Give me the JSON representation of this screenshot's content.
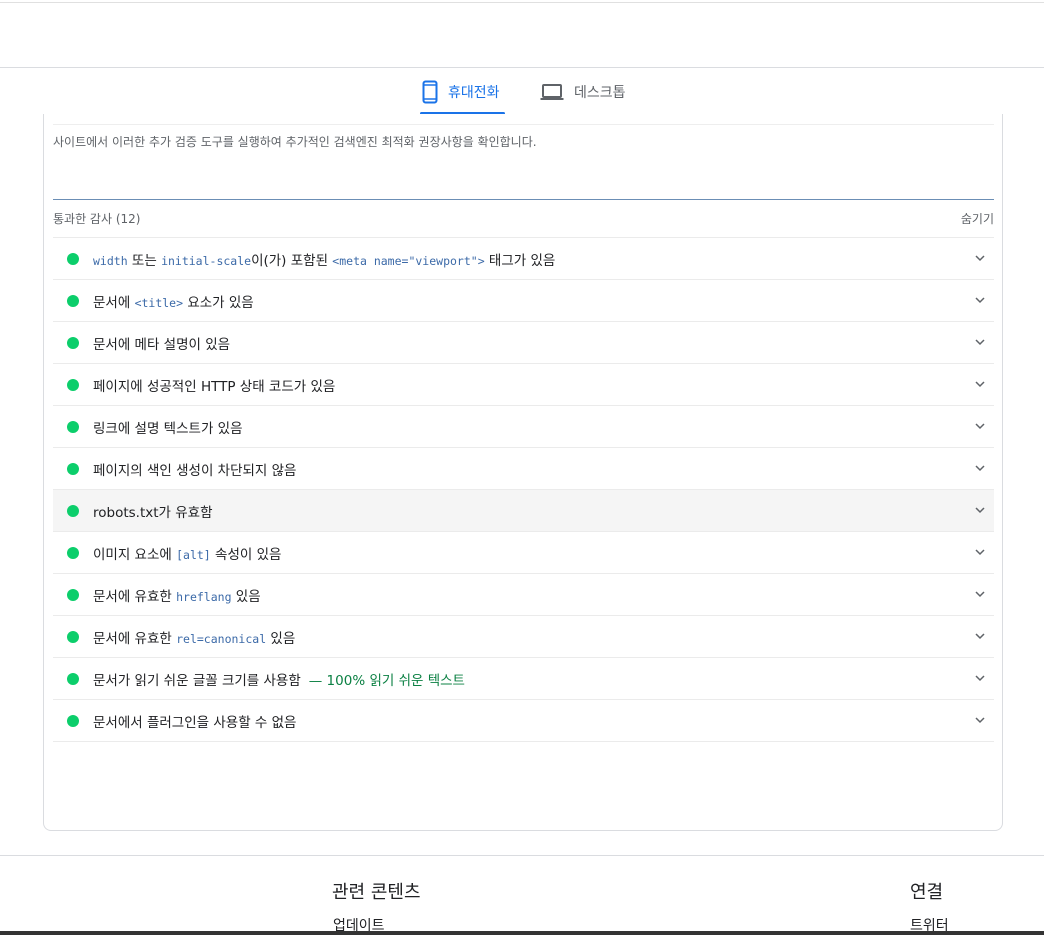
{
  "tabs": {
    "mobile_label": "휴대전화",
    "desktop_label": "데스크톱"
  },
  "description": "사이트에서 이러한 추가 검증 도구를 실행하여 추가적인 검색엔진 최적화 권장사항을 확인합니다.",
  "passed_section": {
    "title": "통과한 감사 (12)",
    "toggle_label": "숨기기"
  },
  "audits": [
    {
      "status": "pass",
      "parts": [
        {
          "t": "width",
          "code": true
        },
        {
          "t": " 또는 "
        },
        {
          "t": "initial-scale",
          "code": true
        },
        {
          "t": "이(가) 포함된 "
        },
        {
          "t": "<meta name=\"viewport\">",
          "code": true
        },
        {
          "t": " 태그가 있음"
        }
      ]
    },
    {
      "status": "pass",
      "parts": [
        {
          "t": "문서에 "
        },
        {
          "t": "<title>",
          "code": true
        },
        {
          "t": " 요소가 있음"
        }
      ]
    },
    {
      "status": "pass",
      "parts": [
        {
          "t": "문서에 메타 설명이 있음"
        }
      ]
    },
    {
      "status": "pass",
      "parts": [
        {
          "t": "페이지에 성공적인 HTTP 상태 코드가 있음"
        }
      ]
    },
    {
      "status": "pass",
      "parts": [
        {
          "t": "링크에 설명 텍스트가 있음"
        }
      ]
    },
    {
      "status": "pass",
      "parts": [
        {
          "t": "페이지의 색인 생성이 차단되지 않음"
        }
      ]
    },
    {
      "status": "pass",
      "parts": [
        {
          "t": "robots.txt가 유효함"
        }
      ],
      "highlight": true
    },
    {
      "status": "pass",
      "parts": [
        {
          "t": "이미지 요소에 "
        },
        {
          "t": "[alt]",
          "code": true
        },
        {
          "t": " 속성이 있음"
        }
      ]
    },
    {
      "status": "pass",
      "parts": [
        {
          "t": "문서에 유효한 "
        },
        {
          "t": "hreflang",
          "code": true
        },
        {
          "t": " 있음"
        }
      ]
    },
    {
      "status": "pass",
      "parts": [
        {
          "t": "문서에 유효한 "
        },
        {
          "t": "rel=canonical",
          "code": true
        },
        {
          "t": " 있음"
        }
      ]
    },
    {
      "status": "pass",
      "parts": [
        {
          "t": "문서가 읽기 쉬운 글꼴 크기를 사용함"
        }
      ],
      "display_value": "— 100% 읽기 쉬운 텍스트"
    },
    {
      "status": "pass",
      "parts": [
        {
          "t": "문서에서 플러그인을 사용할 수 없음"
        }
      ]
    }
  ],
  "footer": {
    "related_heading": "관련 콘텐츠",
    "related_link": "업데이트",
    "connect_heading": "연결",
    "connect_link": "트위터"
  },
  "colors": {
    "accent": "#1a73e8",
    "pass": "#0cce6b",
    "display_value": "#0b8043",
    "code": "#3c6aa8"
  },
  "icons": {
    "mobile_tab": "smartphone-icon",
    "desktop_tab": "laptop-icon",
    "audit_status": "pass-dot-icon",
    "audit_expand": "chevron-down-icon"
  }
}
